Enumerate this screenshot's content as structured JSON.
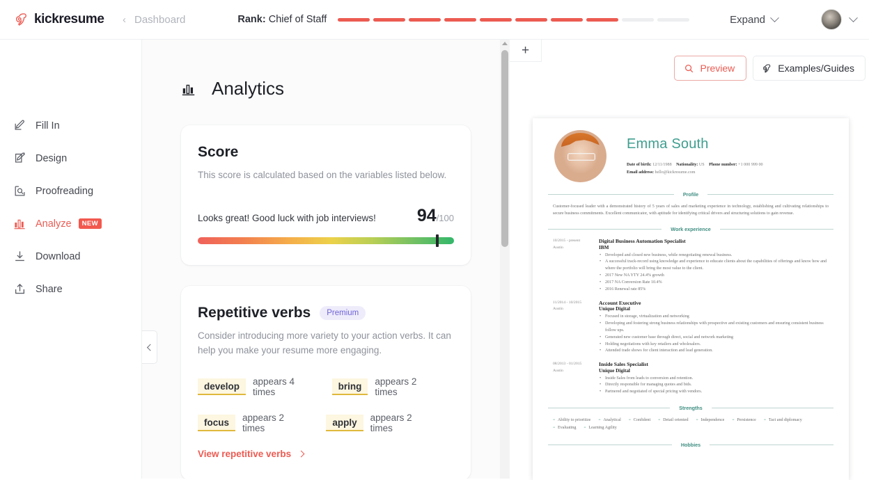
{
  "topbar": {
    "brand": "kickresume",
    "breadcrumb_back_icon": "chevron-left-icon",
    "breadcrumb": "Dashboard",
    "rank_prefix": "Rank:",
    "rank_value": "Chief of Staff",
    "rank_segments_total": 10,
    "rank_segments_filled": 8,
    "accent_color": "#ec5b52",
    "expand_label": "Expand",
    "expand_icon": "chevron-down-icon",
    "avatar_icon": "avatar",
    "account_menu_icon": "chevron-down-icon"
  },
  "sidebar": {
    "items": [
      {
        "label": "Fill In",
        "icon": "pencil-square-icon",
        "active": false,
        "badge": ""
      },
      {
        "label": "Design",
        "icon": "design-pencil-icon",
        "active": false,
        "badge": ""
      },
      {
        "label": "Proofreading",
        "icon": "magnifier-doc-icon",
        "active": false,
        "badge": ""
      },
      {
        "label": "Analyze",
        "icon": "bar-chart-icon",
        "active": true,
        "badge": "NEW"
      },
      {
        "label": "Download",
        "icon": "download-icon",
        "active": false,
        "badge": ""
      },
      {
        "label": "Share",
        "icon": "share-icon",
        "active": false,
        "badge": ""
      }
    ]
  },
  "analytics": {
    "icon": "bar-chart-icon",
    "title": "Analytics",
    "score_card": {
      "title": "Score",
      "subtitle": "This score is calculated based on the variables listed below.",
      "message": "Looks great! Good luck with job interviews!",
      "value": "94",
      "denominator": "/100",
      "percent": 94
    },
    "repetitive_verbs_card": {
      "title": "Repetitive verbs",
      "badge": "Premium",
      "description": "Consider introducing more variety to your action verbs. It can help you make your resume more engaging.",
      "verbs": [
        {
          "word": "develop",
          "count_text": "appears 4 times"
        },
        {
          "word": "bring",
          "count_text": "appears 2 times"
        },
        {
          "word": "focus",
          "count_text": "appears 2 times"
        },
        {
          "word": "apply",
          "count_text": "appears 2 times"
        }
      ],
      "link_label": "View repetitive verbs",
      "link_icon": "chevron-right-icon"
    }
  },
  "preview_panel": {
    "add_tab_icon": "plus-icon",
    "preview_button": {
      "label": "Preview",
      "icon": "search-icon"
    },
    "examples_button": {
      "label": "Examples/Guides",
      "icon": "kickresume-logo-icon"
    }
  },
  "resume": {
    "name": "Emma South",
    "name_color": "#3f9e8f",
    "photo_icon": "profile-photo",
    "contact": {
      "dob_label": "Date of birth:",
      "dob_value": "12/11/1988",
      "nationality_label": "Nationality:",
      "nationality_value": "US",
      "phone_label": "Phone number:",
      "phone_value": "+1 000 999 00",
      "email_label": "Email address:",
      "email_value": "hello@kickresume.com"
    },
    "sections": {
      "profile_heading": "Profile",
      "profile_text": "Customer-focused leader with a demonstrated history of 5 years of sales and marketing experience in technology, establishing and cultivating relationships to secure business commitments. Excellent communicator, with aptitude for identifying critical drivers and structuring solutions to gain revenue.",
      "work_heading": "Work experience",
      "strengths_heading": "Strengths",
      "hobbies_heading": "Hobbies"
    },
    "jobs": [
      {
        "dates": "10/2015 - present",
        "location": "Austin",
        "role": "Digital Business Automation Specialist",
        "company": "IBM",
        "bullets": [
          "Developed and closed new business, while renegotiating renewal business.",
          "A successful track-record using knowledge and experience to educate clients about the capabilities of offerings and know how and where the portfolio will bring the most value to the client.",
          "2017 New NA YTY 24.4% growth",
          "2017 NA Conversion Rate 10.4%",
          "2016 Renewal rate 85%"
        ]
      },
      {
        "dates": "11/2014 - 10/2015",
        "location": "Austin",
        "role": "Account Executive",
        "company": "Unique Digital",
        "bullets": [
          "Focused in storage, virtualization and networking",
          "Developing and fostering strong business relationships with prospective and existing customers and ensuring consistent business follow ups.",
          "Generated new customer base through direct, social and network marketing",
          "Holding negotiations with key retailers and wholesalers.",
          "Attended trade shows for client interaction and lead generation."
        ]
      },
      {
        "dates": "08/2013 - 01/2015",
        "location": "Austin",
        "role": "Inside Sales Specialist",
        "company": "Unique Digital",
        "bullets": [
          "Inside Sales from leads to conversion and retention.",
          "Directly responsible for managing quotes and bids.",
          "Partnered and negotiated of special pricing with vendors."
        ]
      }
    ],
    "strengths": [
      "Ability to prioritize",
      "Analytical",
      "Confident",
      "Detail oriented",
      "Independence",
      "Persistence",
      "Tact and diplomacy",
      "Evaluating",
      "Learning Agility"
    ]
  }
}
